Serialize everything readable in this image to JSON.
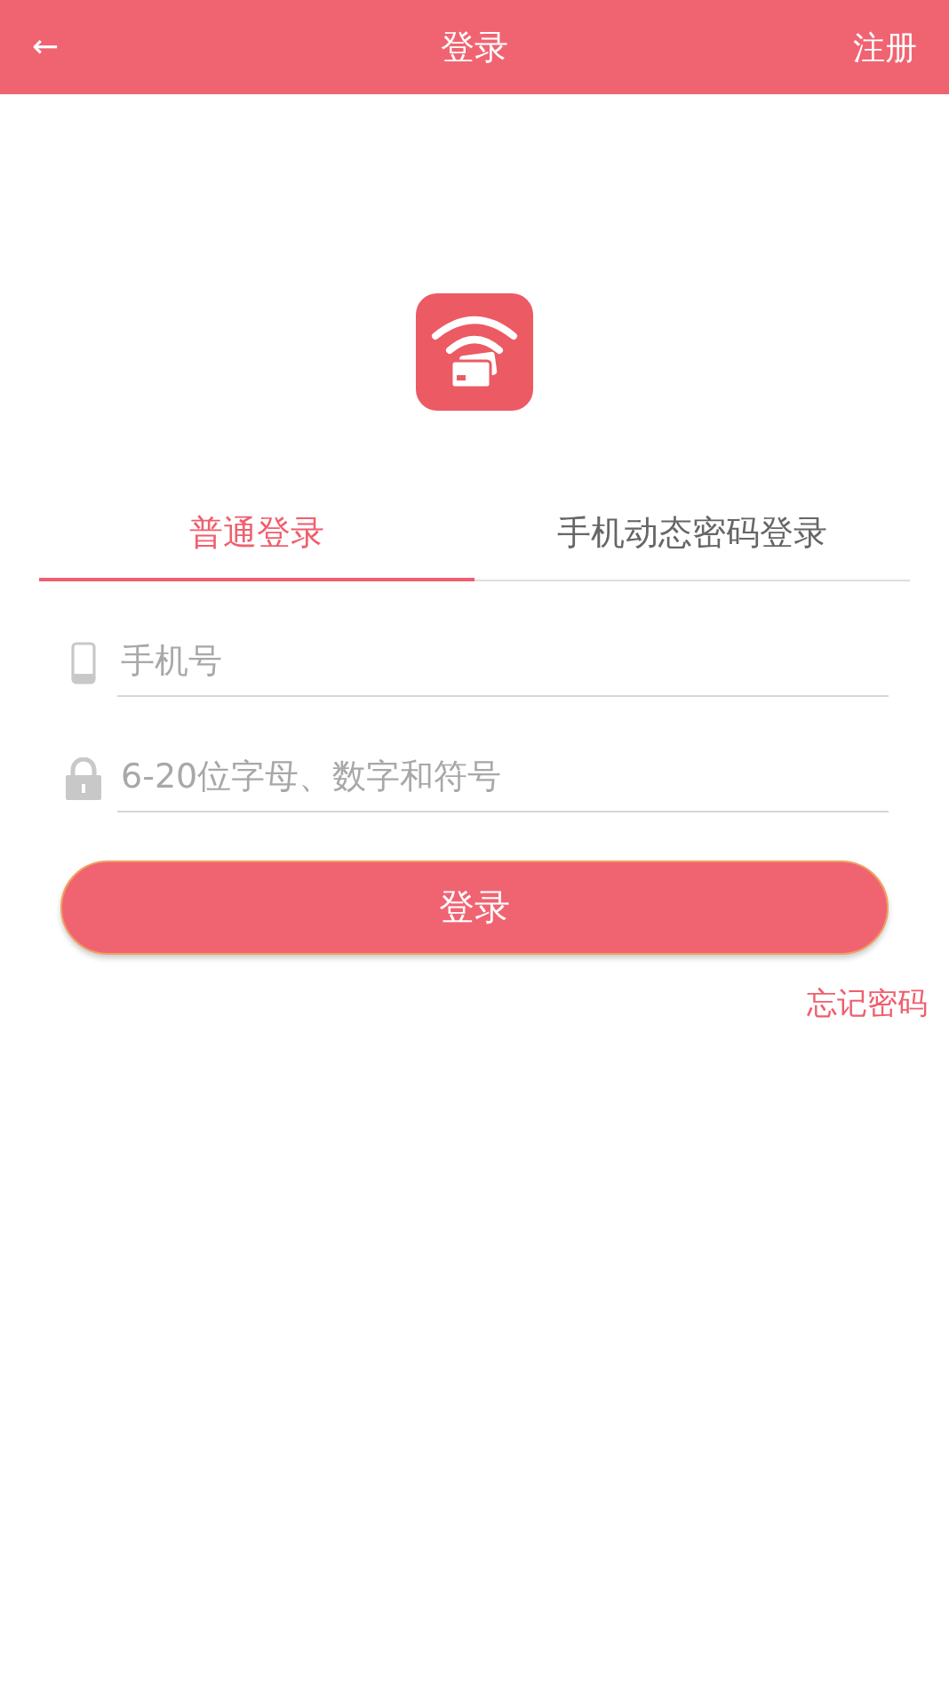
{
  "top_bar": {
    "back_icon": "←",
    "title": "登录",
    "action": "注册"
  },
  "tabs": [
    {
      "label": "普通登录",
      "selected": true
    },
    {
      "label": "手机动态密码登录",
      "selected": false
    }
  ],
  "fields": [
    {
      "kind": "phone",
      "placeholder": "手机号"
    },
    {
      "kind": "password",
      "placeholder": "6-20位字母、数字和符号"
    }
  ],
  "login_button": "登录",
  "forgot_link": "忘记密码"
}
